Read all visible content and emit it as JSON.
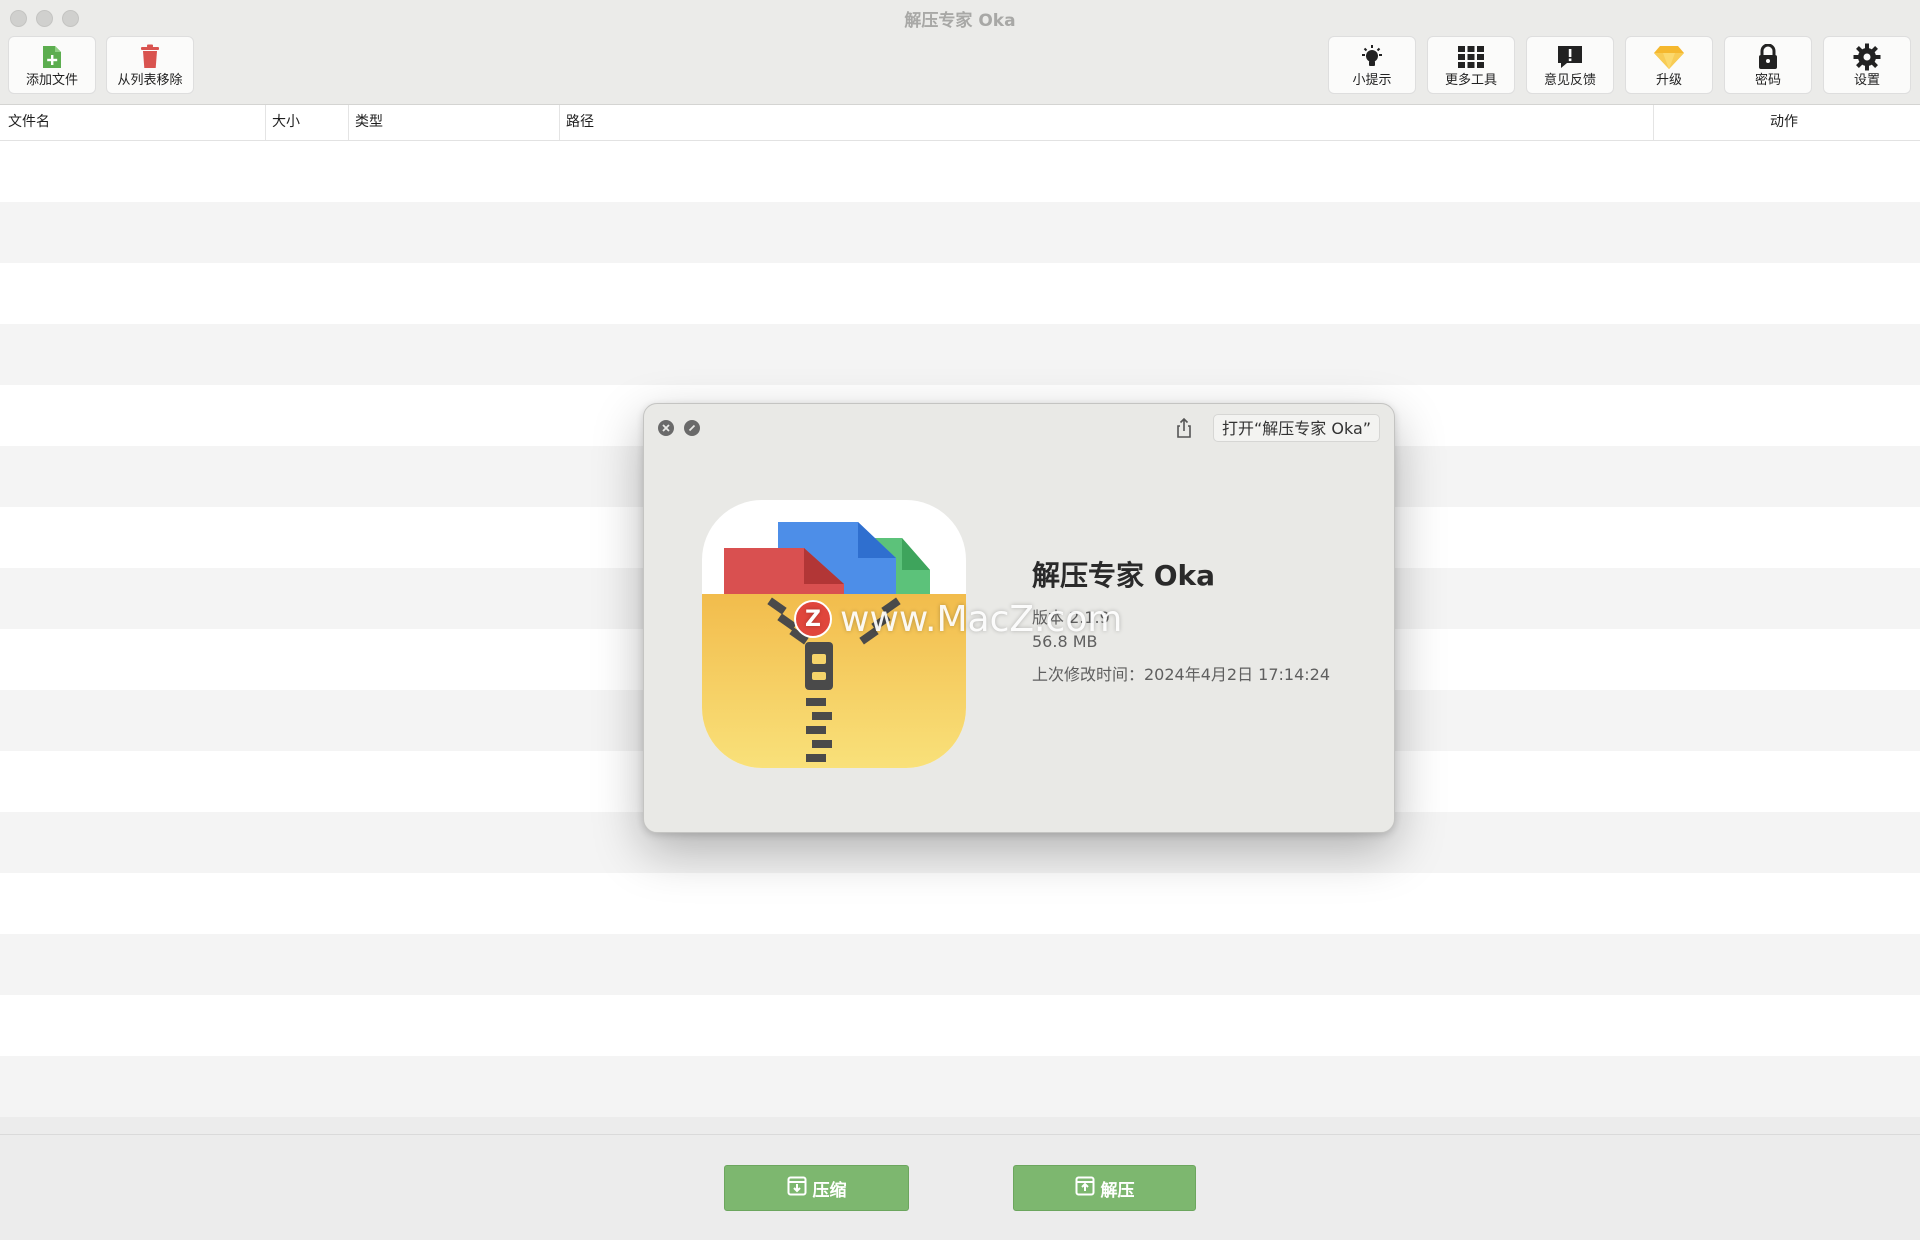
{
  "window": {
    "title": "解压专家 Oka"
  },
  "toolbar": {
    "left": [
      {
        "label": "添加文件",
        "icon": "add-file-icon"
      },
      {
        "label": "从列表移除",
        "icon": "trash-icon"
      }
    ],
    "right": [
      {
        "label": "小提示",
        "icon": "lightbulb-icon"
      },
      {
        "label": "更多工具",
        "icon": "grid-icon"
      },
      {
        "label": "意见反馈",
        "icon": "feedback-icon"
      },
      {
        "label": "升级",
        "icon": "diamond-icon"
      },
      {
        "label": "密码",
        "icon": "lock-icon"
      },
      {
        "label": "设置",
        "icon": "gear-icon"
      }
    ]
  },
  "table": {
    "columns": [
      "文件名",
      "大小",
      "类型",
      "路径",
      "动作"
    ],
    "rows": []
  },
  "footer": {
    "compress_label": "压缩",
    "extract_label": "解压"
  },
  "info_dialog": {
    "open_button_label": "打开“解压专家 Oka”",
    "app_name": "解压专家 Oka",
    "version": "版本 2.1.9",
    "size": "56.8 MB",
    "modified": "上次修改时间：2024年4月2日 17:14:24"
  },
  "watermark": {
    "badge": "Z",
    "text": "www.MacZ.com"
  },
  "colors": {
    "action_button": "#7db76f",
    "add_icon": "#5cad4f",
    "trash_icon": "#d9534f",
    "diamond_icon": "#f5b82e"
  }
}
